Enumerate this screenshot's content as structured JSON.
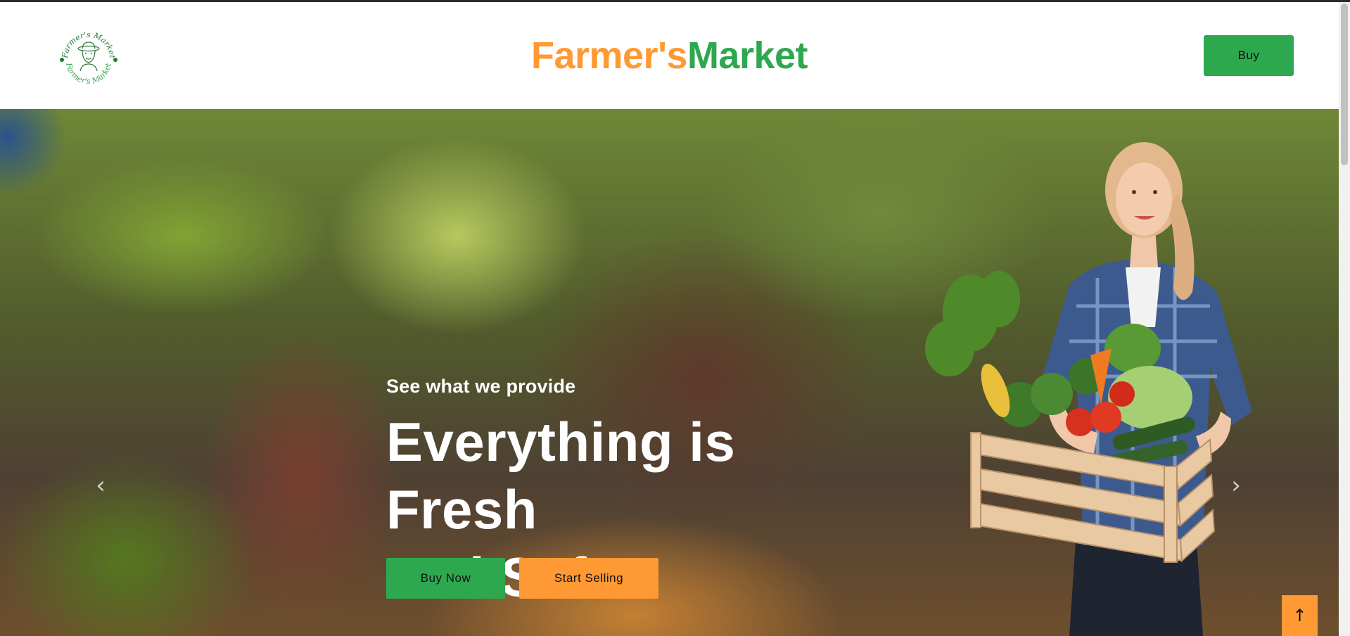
{
  "header": {
    "logo_text": "Farmer's Market",
    "brand_part1": "Farmer's",
    "brand_part2": "Market",
    "buy_label": "Buy"
  },
  "hero": {
    "subtitle": "See what we provide",
    "title_line1": "Everything is Fresh",
    "title_line2": "and Safe",
    "buy_now_label": "Buy Now",
    "start_selling_label": "Start Selling",
    "prev_icon": "‹",
    "next_icon": "›"
  },
  "back_to_top_icon": "↑",
  "colors": {
    "orange": "#ff9933",
    "green": "#2ea84f"
  }
}
